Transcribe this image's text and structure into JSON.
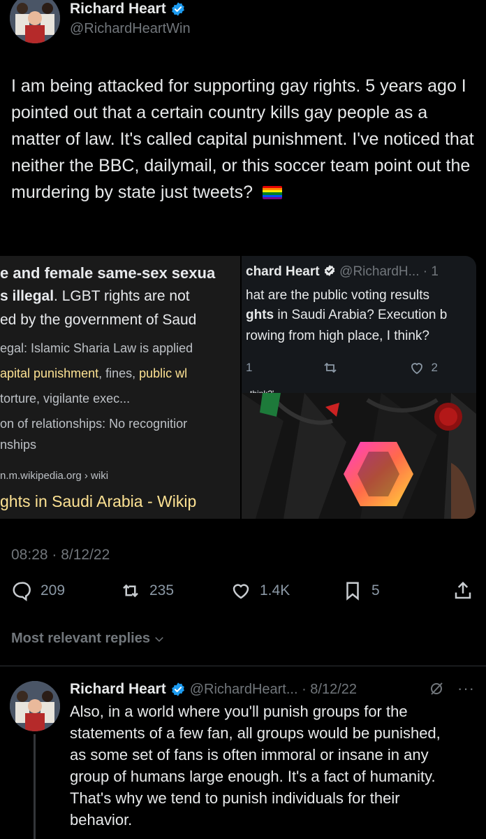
{
  "tweet": {
    "author_name": "Richard Heart",
    "handle": "@RichardHeartWin",
    "text": "I am being attacked for supporting gay rights. 5 years ago I pointed out that a certain country kills gay people as a matter of law. It's called capital punishment. I've noticed that neither the BBC, dailymail, or this soccer team point out the murdering by state just tweets?",
    "flag_emoji": "rainbow-flag",
    "timestamp": "08:28 · 8/12/22",
    "stats": {
      "replies": "209",
      "retweets": "235",
      "likes": "1.4K",
      "bookmarks": "5"
    }
  },
  "media_left": {
    "line1": "e and female same-sex sexua",
    "line2_bold": "s illegal",
    "line2_rest": ". LGBT rights are not",
    "line3": "ed by the government of Saud",
    "line4": "egal: Islamic Sharia Law is applied",
    "line5_a": "apital punishment",
    "line5_b": ", fines, ",
    "line5_c": "public wl",
    "line6": "torture, vigilante exec...",
    "line7": "on of relationships: No recognitior",
    "line8": "nships",
    "source": "n.m.wikipedia.org › wiki",
    "link_title": "ghts in Saudi Arabia - Wikip"
  },
  "media_right": {
    "name": "chard Heart",
    "handle_time": "@RichardH... · 1",
    "line1": "hat are the public voting results",
    "line2_bold": "ghts",
    "line2_rest": " in Saudi Arabia? Execution b",
    "line3": "rowing from high place, I think?",
    "reply_count": "1",
    "like_count": "2",
    "caption": "think?'"
  },
  "sort_label": "Most relevant replies",
  "reply": {
    "author_name": "Richard Heart",
    "handle_time": "@RichardHeart... · 8/12/22",
    "text": "Also, in a world where you'll punish groups for the statements of a few fan, all groups would be punished, as some set of fans is often immoral or insane in any group of humans large enough. It's a fact of humanity. That's why we tend to punish individuals for their behavior.",
    "more": "···"
  },
  "colors": {
    "background": "#000000",
    "text": "#e7e9ea",
    "muted": "#71767b",
    "verified": "#1d9bf0",
    "highlight": "#fde293"
  }
}
